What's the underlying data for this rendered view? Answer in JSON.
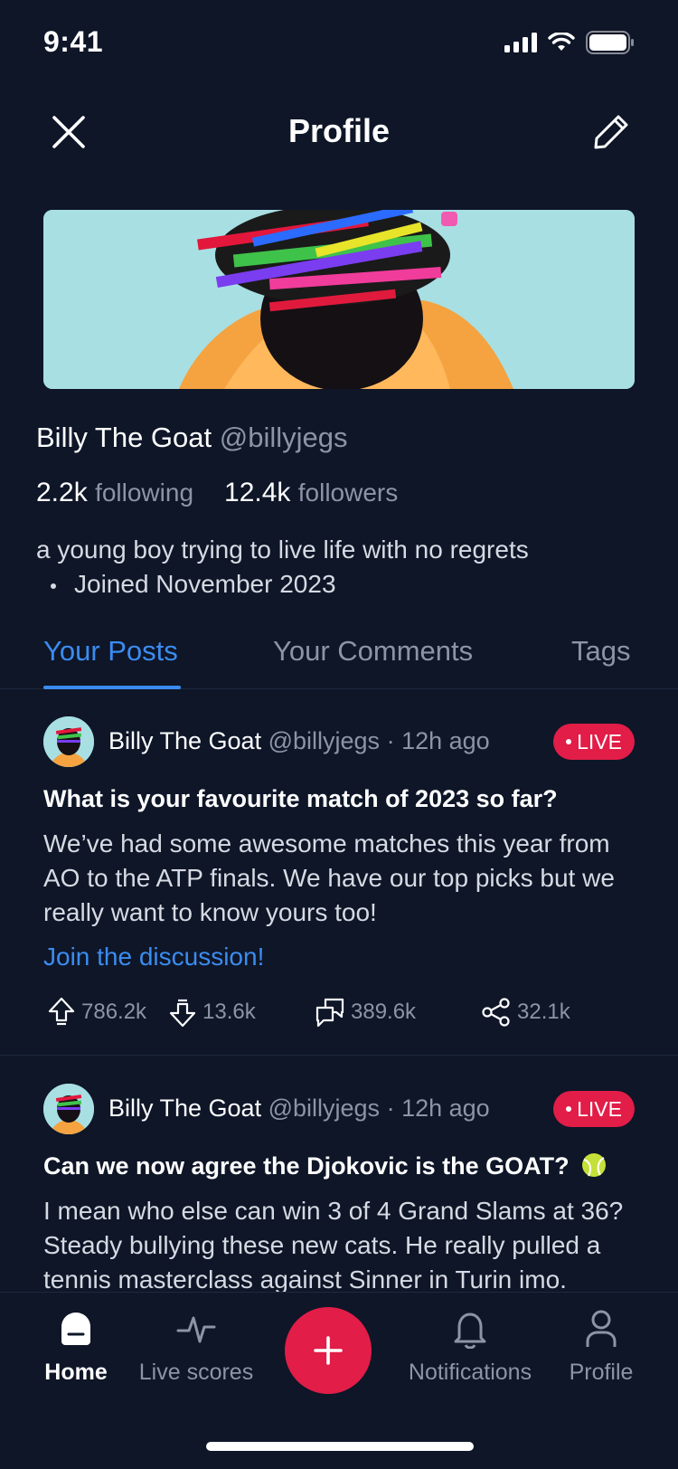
{
  "status_bar": {
    "time": "9:41"
  },
  "header": {
    "title": "Profile"
  },
  "profile": {
    "name": "Billy The Goat",
    "handle": "@billyjegs",
    "following_count": "2.2k",
    "following_label": "following",
    "followers_count": "12.4k",
    "followers_label": "followers",
    "bio": "a young boy trying to live life with no regrets",
    "joined": "Joined November 2023"
  },
  "tabs": [
    {
      "label": "Your Posts",
      "active": true
    },
    {
      "label": "Your Comments",
      "active": false
    },
    {
      "label": "Tags",
      "active": false
    }
  ],
  "posts": [
    {
      "author": "Billy The Goat",
      "handle": "@billyjegs",
      "time": "· 12h ago",
      "badge": "LIVE",
      "title": "What is your favourite match of 2023 so far?",
      "body": "We’ve had some awesome matches this year from AO to the ATP finals. We have our top picks but we really want to know yours too!",
      "link": "Join the discussion!",
      "upvotes": "786.2k",
      "downvotes": "13.6k",
      "comments": "389.6k",
      "shares": "32.1k"
    },
    {
      "author": "Billy The Goat",
      "handle": "@billyjegs",
      "time": "· 12h ago",
      "badge": "LIVE",
      "title": "Can we now agree the Djokovic is the GOAT?",
      "body": "I mean who else can win 3 of 4 Grand Slams at 36? Steady bullying these new cats. He really pulled a tennis masterclass against Sinner in Turin imo."
    }
  ],
  "bottom_nav": [
    {
      "label": "Home",
      "icon": "home-icon",
      "active": true
    },
    {
      "label": "Live scores",
      "icon": "pulse-icon",
      "active": false
    },
    {
      "label": "Notifications",
      "icon": "bell-icon",
      "active": false
    },
    {
      "label": "Profile",
      "icon": "user-icon",
      "active": false
    }
  ],
  "colors": {
    "background": "#0E1628",
    "accent": "#3B8CF0",
    "live": "#E11D48",
    "muted": "#8C94A6"
  }
}
